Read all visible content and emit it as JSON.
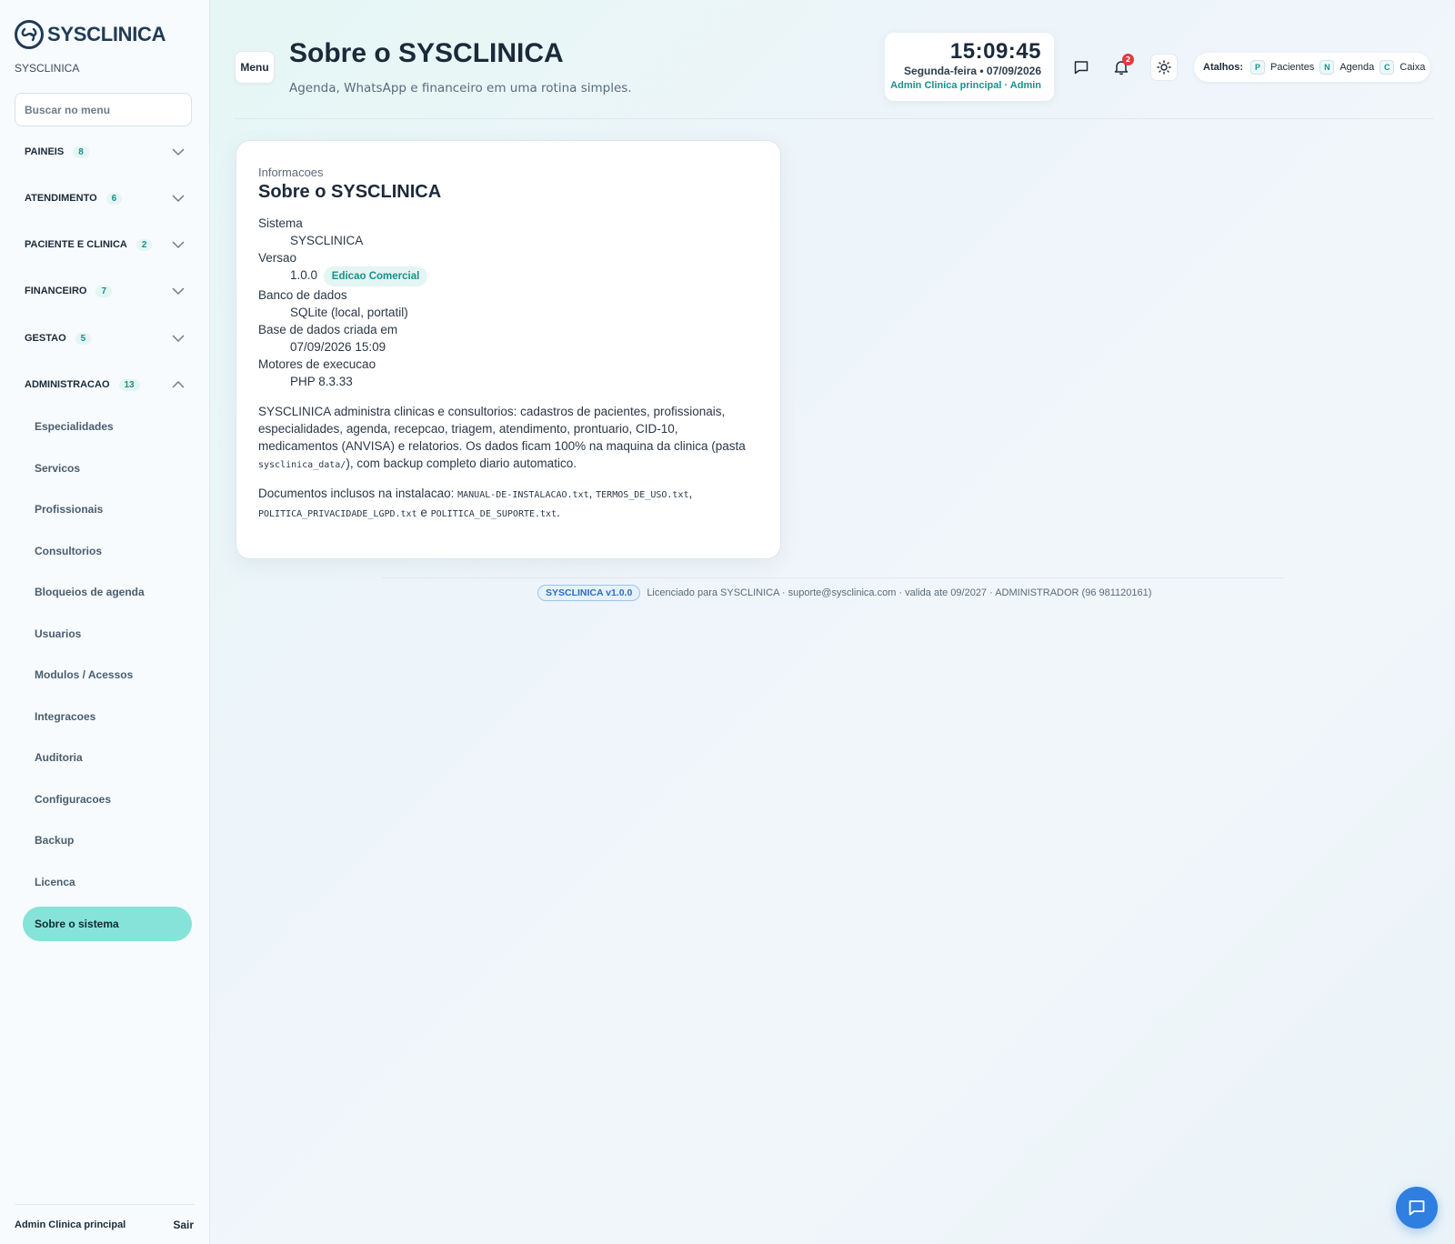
{
  "sidebar": {
    "brand": "SYSCLINICA",
    "brand_sub": "SYSCLINICA",
    "search_placeholder": "Buscar no menu",
    "groups": [
      {
        "label": "PAINEIS",
        "count": "8"
      },
      {
        "label": "ATENDIMENTO",
        "count": "6"
      },
      {
        "label": "PACIENTE E CLINICA",
        "count": "2"
      },
      {
        "label": "FINANCEIRO",
        "count": "7"
      },
      {
        "label": "GESTAO",
        "count": "5"
      },
      {
        "label": "ADMINISTRACAO",
        "count": "13"
      }
    ],
    "admin_items": [
      "Especialidades",
      "Servicos",
      "Profissionais",
      "Consultorios",
      "Bloqueios de agenda",
      "Usuarios",
      "Modulos / Acessos",
      "Integracoes",
      "Auditoria",
      "Configuracoes",
      "Backup",
      "Licenca",
      "Sobre o sistema"
    ],
    "user": "Admin Clinica principal",
    "logout": "Sair"
  },
  "header": {
    "menu_label": "Menu",
    "title": "Sobre o SYSCLINICA",
    "subtitle": "Agenda, WhatsApp e financeiro em uma rotina simples.",
    "clock_time": "15:09:45",
    "clock_date": "Segunda-feira • 07/09/2026",
    "clock_user": "Admin Clinica principal · Admin",
    "notifications_count": "2",
    "shortcuts_label": "Atalhos:",
    "shortcuts": [
      {
        "key": "P",
        "label": "Pacientes"
      },
      {
        "key": "N",
        "label": "Agenda"
      },
      {
        "key": "C",
        "label": "Caixa"
      }
    ]
  },
  "card": {
    "kicker": "Informacoes",
    "title": "Sobre o SYSCLINICA",
    "system_label": "Sistema",
    "system_value": "SYSCLINICA",
    "version_label": "Versao",
    "version_value": "1.0.0",
    "edition": "Edicao Comercial",
    "db_label": "Banco de dados",
    "db_value": "SQLite (local, portatil)",
    "db_created_label": "Base de dados criada em",
    "db_created_value": "07/09/2026 15:09",
    "engines_label": "Motores de execucao",
    "engines_value": "PHP 8.3.33",
    "desc_part1": "SYSCLINICA administra clinicas e consultorios: cadastros de pacientes, profissionais, especialidades, agenda, recepcao, triagem, atendimento, prontuario, CID-10, medicamentos (ANVISA) e relatorios. Os dados ficam 100% na maquina da clinica (pasta ",
    "desc_code": "sysclinica_data/",
    "desc_part2": "), com backup completo diario automatico.",
    "docs_intro": "Documentos inclusos na instalacao: ",
    "doc1": "MANUAL-DE-INSTALACAO.txt",
    "doc_sep1": ", ",
    "doc2": "TERMOS_DE_USO.txt",
    "doc_sep2": ", ",
    "doc3": "POLITICA_PRIVACIDADE_LGPD.txt",
    "doc_sep3": " e ",
    "doc4": "POLITICA_DE_SUPORTE.txt",
    "doc_end": "."
  },
  "footer": {
    "version_badge": "SYSCLINICA v1.0.0",
    "license_text": "Licenciado para SYSCLINICA · suporte@sysclinica.com · valida ate 09/2027 · ADMINISTRADOR (96 981120161)"
  },
  "colors": {
    "accent": "#17928a",
    "active_item": "#86e3d9",
    "fab": "#2f7fe0",
    "badge_red": "#e23b3b"
  }
}
